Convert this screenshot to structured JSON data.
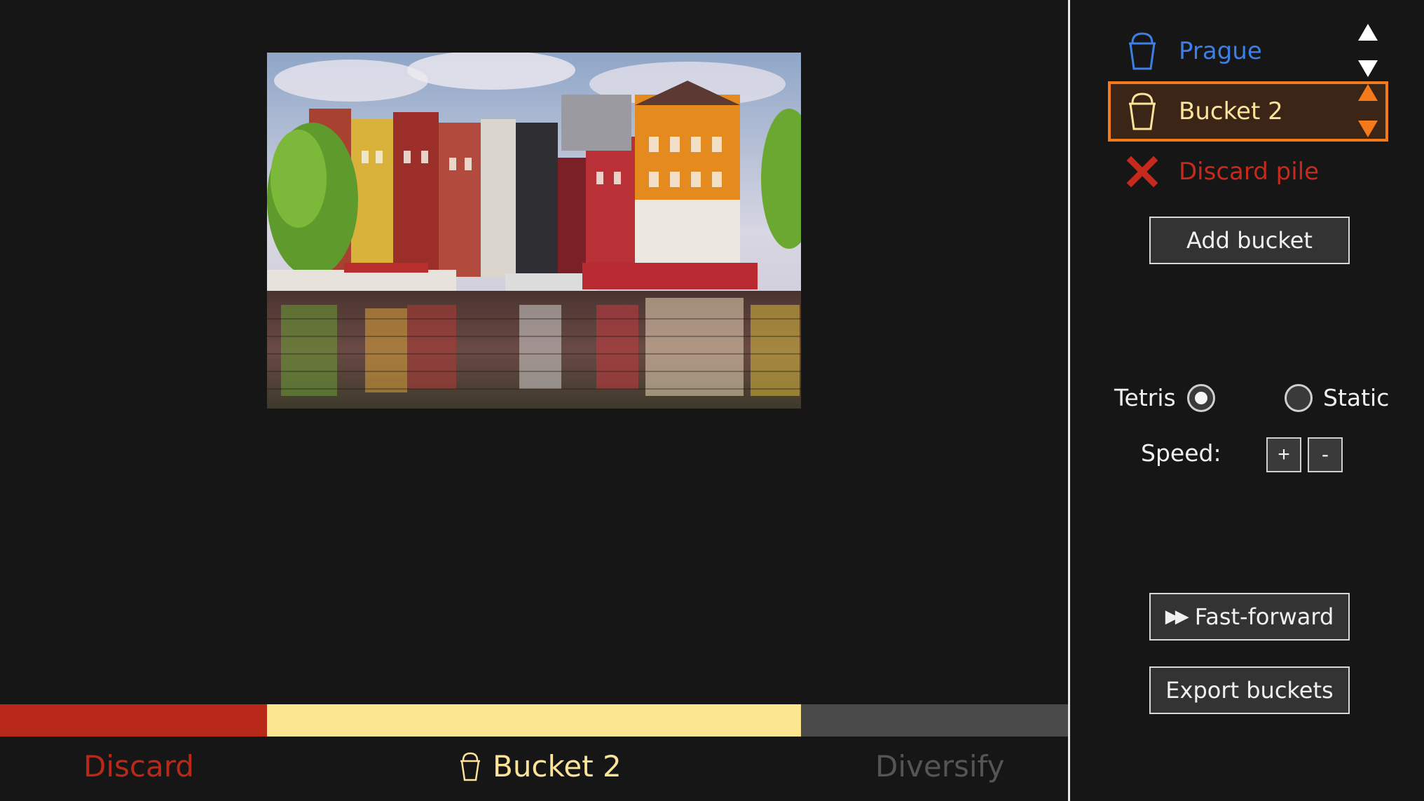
{
  "colors": {
    "background": "#161616",
    "discard_red": "#b8291a",
    "bucket_yellow": "#fde690",
    "diversify_gray": "#4a4a4a",
    "prague_blue": "#3d7fe6",
    "selected_orange": "#f57a1c",
    "selected_text": "#fbe39a",
    "diversify_text": "#555555"
  },
  "sidebar": {
    "buckets": [
      {
        "name": "Prague",
        "icon": "bucket-icon",
        "color": "#3d7fe6",
        "selected": false
      },
      {
        "name": "Bucket 2",
        "icon": "bucket-icon",
        "color": "#fbe39a",
        "selected": true
      }
    ],
    "discard": {
      "name": "Discard pile",
      "icon": "x-icon",
      "color": "#c62a1c"
    },
    "add_bucket_label": "Add bucket",
    "mode": {
      "options": [
        "Tetris",
        "Static"
      ],
      "selected": "Tetris"
    },
    "speed_label": "Speed:",
    "speed_plus": "+",
    "speed_minus": "-",
    "fast_forward_icon": "▶▶",
    "fast_forward_label": "Fast-forward",
    "export_label": "Export buckets"
  },
  "bottom": {
    "discard_label": "Discard",
    "bucket_label": "Bucket 2",
    "diversify_label": "Diversify"
  }
}
